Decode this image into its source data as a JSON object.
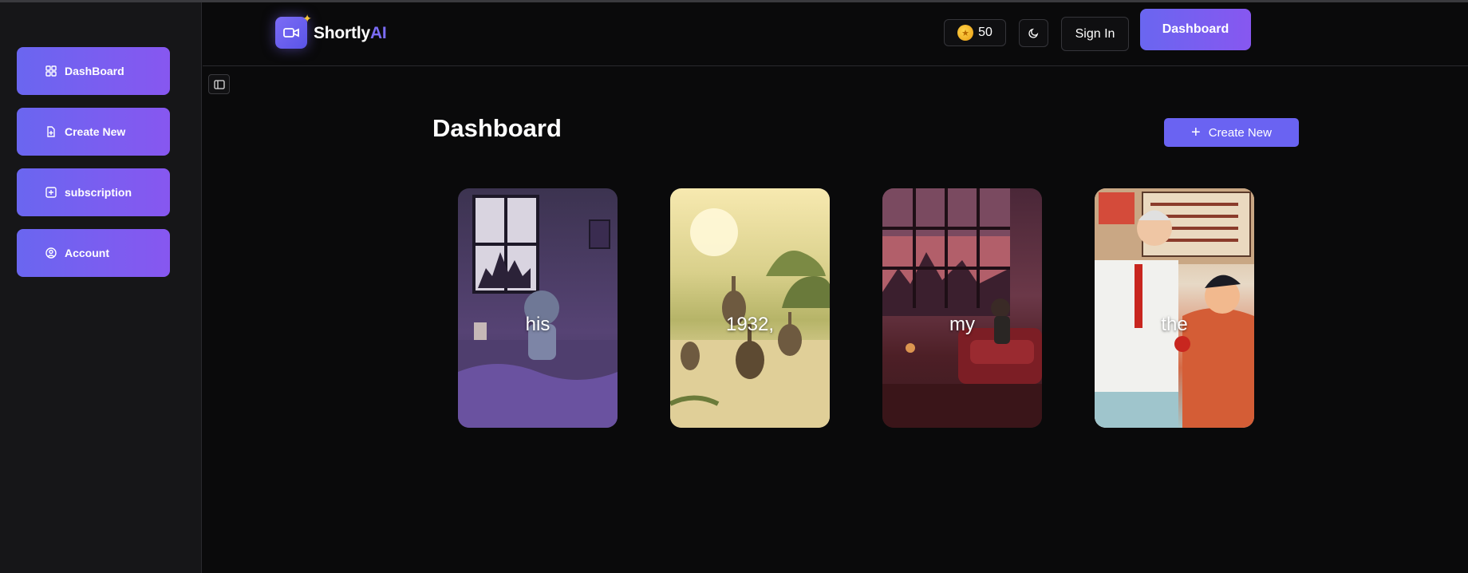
{
  "sidebar": {
    "items": [
      {
        "label": "DashBoard",
        "icon": "dashboard-icon"
      },
      {
        "label": "Create New",
        "icon": "file-plus-icon"
      },
      {
        "label": "subscription",
        "icon": "square-plus-icon"
      },
      {
        "label": "Account",
        "icon": "user-circle-icon"
      }
    ]
  },
  "header": {
    "brand_main": "Shortly",
    "brand_accent": "AI",
    "coins": "50",
    "signin_label": "Sign In",
    "dashboard_label": "Dashboard"
  },
  "main": {
    "title": "Dashboard",
    "create_label": "Create New",
    "cards": [
      {
        "caption": "his"
      },
      {
        "caption": "1932,"
      },
      {
        "caption": "my"
      },
      {
        "caption": "the"
      }
    ]
  },
  "colors": {
    "accent": "#6a63f2",
    "gradient_start": "#6a66f0",
    "gradient_end": "#8757f0",
    "background": "#0a0a0b",
    "sidebar_bg": "#161618"
  }
}
